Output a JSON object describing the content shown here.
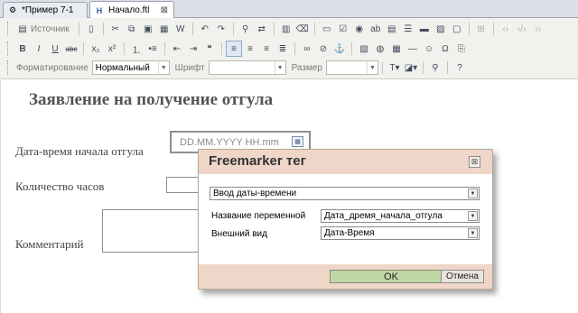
{
  "tabs": [
    {
      "label": "*Пример 7-1",
      "icon": "gear-icon"
    },
    {
      "label": "Начало.ftl",
      "icon": "html-file-icon",
      "close": "⊠"
    }
  ],
  "toolbar": {
    "source_label": "Источник",
    "format_label": "Форматирование",
    "format_value": "Нормальный",
    "font_label": "Шрифт",
    "font_value": "",
    "size_label": "Размер",
    "size_value": ""
  },
  "document": {
    "title": "Заявление на получение отгула",
    "start_label": "Дата-время начала отгула",
    "start_placeholder": "DD.MM.YYYY HH.mm",
    "hours_label": "Количество часов",
    "comment_label": "Комментарий"
  },
  "dialog": {
    "title": "Freemarker тег",
    "close": "⊠",
    "type_value": "Ввод даты-времени",
    "var_label": "Название переменной",
    "var_value": "Дата_дремя_начала_отгула",
    "view_label": "Внешний вид",
    "view_value": "Дата-Время",
    "ok_label": "OK",
    "cancel_label": "Отмена"
  },
  "colors": {
    "dialog_header": "#efd6c8",
    "ok_button": "#bfd7a4",
    "document_title": "#555555"
  }
}
